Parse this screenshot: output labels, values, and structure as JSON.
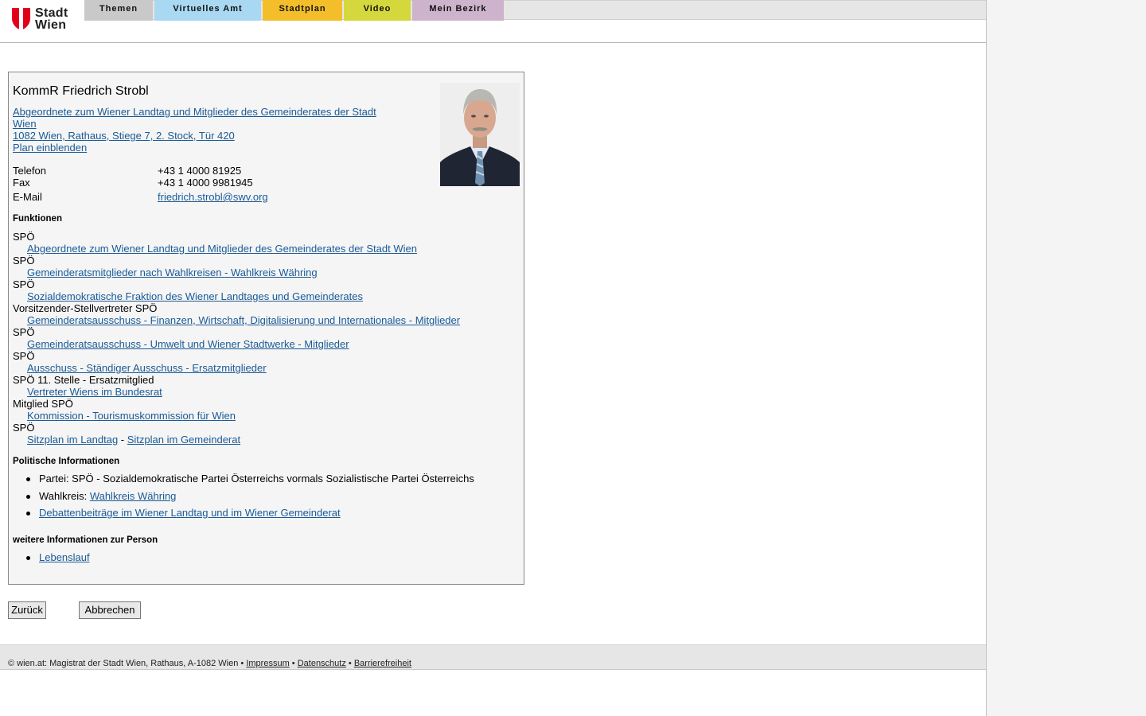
{
  "logo": {
    "line1": "Stadt",
    "line2": "Wien"
  },
  "nav": {
    "tabs": [
      "Themen",
      "Virtuelles Amt",
      "Stadtplan",
      "Video",
      "Mein Bezirk"
    ]
  },
  "person": {
    "name": "KommR Friedrich Strobl",
    "org_line1": "Abgeordnete zum Wiener Landtag und Mitglieder des Gemeinderates der Stadt",
    "org_line2": "Wien ",
    "address": "1082 Wien, Rathaus, Stiege 7, 2. Stock, Tür 420",
    "plan_link": "Plan einblenden",
    "phone_label": "Telefon",
    "phone": "+43 1 4000 81925",
    "fax_label": "Fax",
    "fax": "+43 1 4000 9981945",
    "email_label": "E-Mail",
    "email": "friedrich.strobl@swv.org"
  },
  "functions": {
    "heading": "Funktionen",
    "items": [
      {
        "role": "SPÖ",
        "link": "Abgeordnete zum Wiener Landtag und Mitglieder des Gemeinderates der Stadt Wien"
      },
      {
        "role": "SPÖ",
        "link": "Gemeinderatsmitglieder nach Wahlkreisen - Wahlkreis Währing"
      },
      {
        "role": "SPÖ",
        "link": "Sozialdemokratische Fraktion des Wiener Landtages und Gemeinderates"
      },
      {
        "role": "Vorsitzender-Stellvertreter SPÖ",
        "link": "Gemeinderatsausschuss - Finanzen, Wirtschaft, Digitalisierung und Internationales - Mitglieder"
      },
      {
        "role": "SPÖ",
        "link": "Gemeinderatsausschuss - Umwelt und Wiener Stadtwerke - Mitglieder"
      },
      {
        "role": "SPÖ",
        "link": "Ausschuss - Ständiger Ausschuss - Ersatzmitglieder"
      },
      {
        "role": "SPÖ 11. Stelle - Ersatzmitglied",
        "link": "Vertreter Wiens im Bundesrat"
      },
      {
        "role": "Mitglied SPÖ",
        "link": "Kommission - Tourismuskommission für Wien"
      },
      {
        "role": "SPÖ",
        "link": "Sitzplan im Landtag",
        "separator": " - ",
        "link2": "Sitzplan im Gemeinderat"
      }
    ]
  },
  "political": {
    "heading": "Politische Informationen",
    "party_text": "Partei: SPÖ - Sozialdemokratische Partei Österreichs vormals Sozialistische Partei Österreichs",
    "district_label": "Wahlkreis: ",
    "district_link": "Wahlkreis Währing",
    "debates_link": "Debattenbeiträge im Wiener Landtag und im Wiener Gemeinderat"
  },
  "more": {
    "heading": "weitere Informationen zur Person",
    "cv_link": "Lebenslauf"
  },
  "buttons": {
    "back": "Zurück",
    "cancel": "Abbrechen"
  },
  "footer": {
    "text": "© wien.at: Magistrat der Stadt Wien, Rathaus, A-1082 Wien",
    "sep": " • ",
    "links": [
      "Impressum",
      "Datenschutz",
      "Barrierefreiheit"
    ]
  }
}
